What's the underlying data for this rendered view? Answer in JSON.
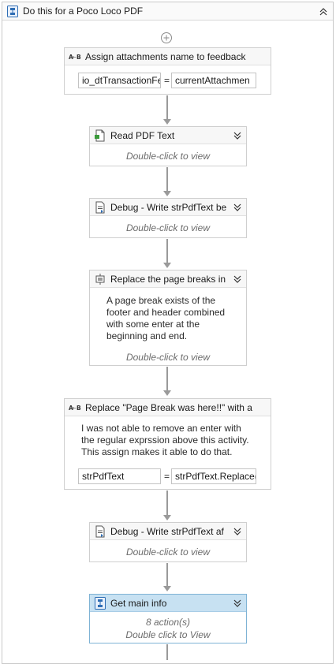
{
  "container": {
    "title": "Do this for a Poco Loco PDF"
  },
  "activities": {
    "assign1": {
      "title": "Assign attachments name to feedback",
      "left_value": "io_dtTransactionFe",
      "operator": "=",
      "right_value": "currentAttachmen"
    },
    "read_pdf": {
      "title": "Read PDF Text",
      "hint": "Double-click to view"
    },
    "debug1": {
      "title": "Debug - Write strPdfText be",
      "hint": "Double-click to view"
    },
    "replace_breaks": {
      "title": "Replace the page breaks in",
      "annotation_lines": [
        "A page break exists of the",
        "footer and header combined",
        "with some enter at the",
        "beginning and end."
      ],
      "hint": "Double-click to view"
    },
    "assign2": {
      "title": "Replace \"Page Break was here!!\" with a",
      "annotation_lines": [
        "I was not able to remove an enter with",
        "the regular exprssion above this activity.",
        "This assign makes it able to do that."
      ],
      "left_value": "strPdfText",
      "operator": "=",
      "right_value": "strPdfText.Replace("
    },
    "debug2": {
      "title": "Debug - Write strPdfText af",
      "hint": "Double-click to view"
    },
    "get_main_info": {
      "title": "Get main info",
      "actions": "8 action(s)",
      "hint": "Double click to View"
    }
  },
  "colors": {
    "selected_header": "#c7e1f2",
    "icon_blue": "#2e6db4",
    "connector": "#9a9a9a"
  }
}
